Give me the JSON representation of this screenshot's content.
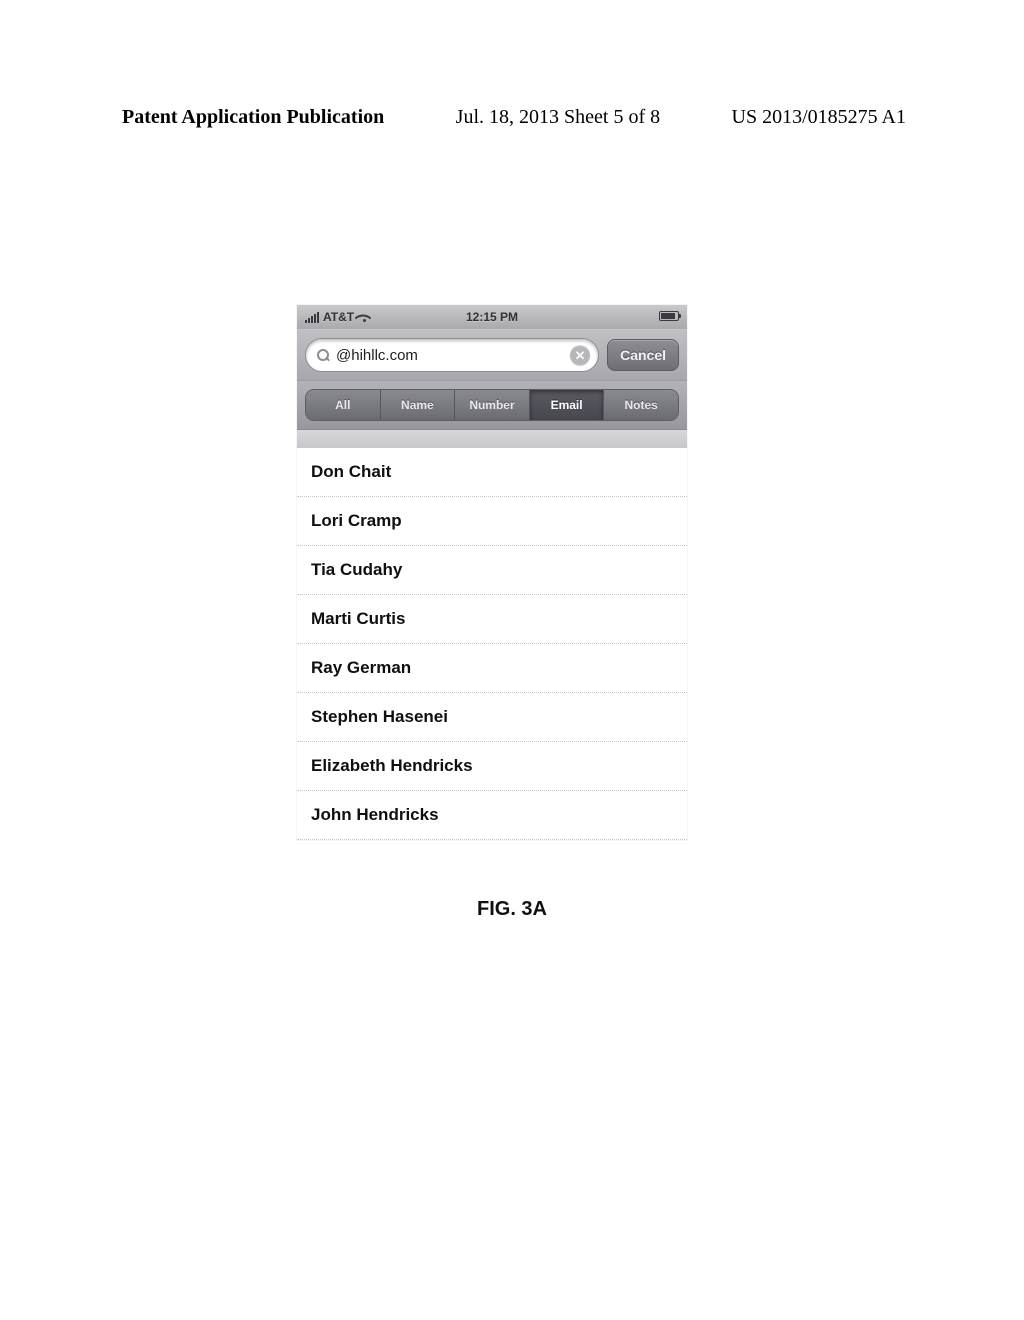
{
  "page_header": {
    "left": "Patent Application Publication",
    "center": "Jul. 18, 2013  Sheet 5 of 8",
    "right": "US 2013/0185275 A1"
  },
  "status": {
    "carrier": "AT&T",
    "time": "12:15 PM"
  },
  "search": {
    "value": "@hihllc.com",
    "cancel_label": "Cancel"
  },
  "scopes": {
    "items": [
      "All",
      "Name",
      "Number",
      "Email",
      "Notes"
    ],
    "active_index": 3
  },
  "results": [
    "Don Chait",
    "Lori Cramp",
    "Tia Cudahy",
    "Marti Curtis",
    "Ray German",
    "Stephen Hasenei",
    "Elizabeth Hendricks",
    "John Hendricks"
  ],
  "figure_label": "FIG. 3A"
}
